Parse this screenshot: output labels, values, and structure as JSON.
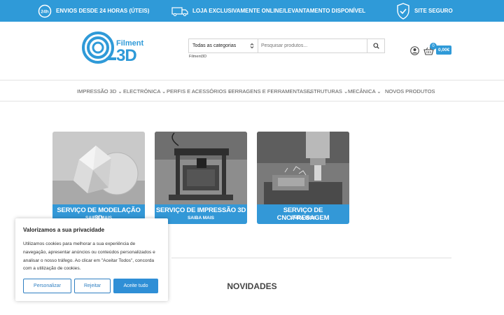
{
  "topbar": {
    "delivery_badge": "24h",
    "delivery": "ENVIOS DESDE 24 HORAS (ÚTEIS)",
    "store": "LOJA EXCLUSIVAMENTE ONLINE/LEVANTAMENTO DISPONÍVEL",
    "secure": "SITE SEGURO"
  },
  "logo": {
    "line1": "Filment",
    "line2": "3D"
  },
  "search": {
    "category": "Todas as categorias",
    "placeholder": "Pesquisar produtos...",
    "under_label": "Filment3D"
  },
  "cart": {
    "count": "0",
    "total": "0,00€"
  },
  "nav": [
    "IMPRESSÃO 3D",
    "ELECTRÓNICA",
    "PERFIS E ACESSÓRIOS",
    "FERRAGENS E FERRAMENTAS",
    "ESTRUTURAS",
    "MECÂNICA",
    "NOVOS PRODUTOS"
  ],
  "cards": [
    {
      "title": "SERVIÇO DE MODELAÇÃO 3D",
      "sub": "SAIBA MAIS"
    },
    {
      "title": "SERVIÇO DE IMPRESSÃO 3D",
      "sub": "SAIBA MAIS"
    },
    {
      "title": "SERVIÇO DE CNC/FRESAGEM",
      "sub": "SAIBA MAIS"
    }
  ],
  "section_title": "NOVIDADES",
  "cookie": {
    "title": "Valorizamos a sua privacidade",
    "body": "Utilizamos cookies para melhorar a sua experiência de navegação, apresentar anúncios ou conteúdos personalizados e analisar o nosso tráfego. Ao clicar em \"Aceitar Todos\", concorda com a utilização de cookies.",
    "customize": "Personalizar",
    "reject": "Rejeitar",
    "accept": "Aceite tudo"
  },
  "colors": {
    "brand": "#2f9ad8",
    "caption": "#3398d7"
  }
}
